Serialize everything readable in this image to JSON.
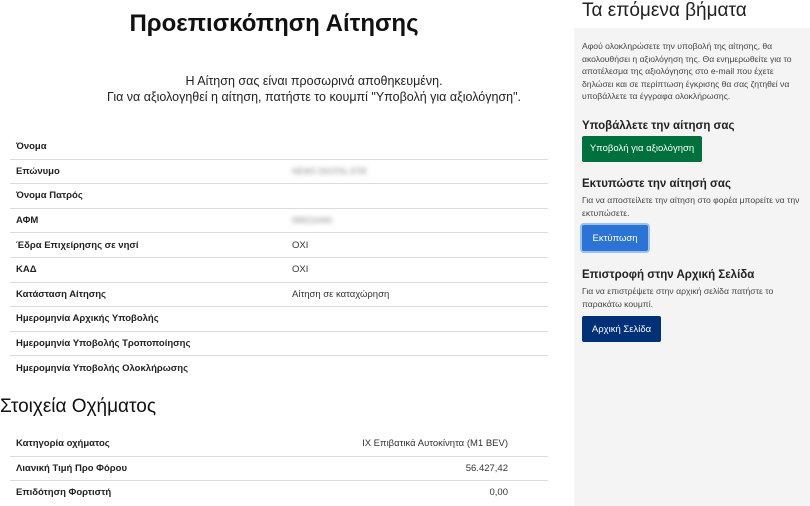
{
  "page": {
    "title": "Προεπισκόπηση Αίτησης",
    "notice_line1": "Η Αίτηση σας είναι προσωρινά αποθηκευμένη.",
    "notice_line2": "Για να αξιολογηθεί η αίτηση, πατήστε το κουμπί \"Υποβολή για αξιολόγηση\"."
  },
  "applicant": {
    "rows": [
      {
        "label": "Όνομα",
        "value": ""
      },
      {
        "label": "Επώνυμο",
        "value": "ΝΕΜΟ DIGITAL ΕΠΕ",
        "redacted": true
      },
      {
        "label": "Όνομα Πατρός",
        "value": ""
      },
      {
        "label": "ΑΦΜ",
        "value": "999210440",
        "redacted": true
      },
      {
        "label": "Έδρα Επιχείρησης σε νησί",
        "value": "ΟΧΙ"
      },
      {
        "label": "ΚΑΔ",
        "value": "ΟΧΙ"
      },
      {
        "label": "Κατάσταση Αίτησης",
        "value": "Αίτηση σε καταχώρηση"
      },
      {
        "label": "Ημερομηνία Αρχικής Υποβολής",
        "value": ""
      },
      {
        "label": "Ημερομηνία Υποβολής Τροποποίησης",
        "value": ""
      },
      {
        "label": "Ημερομηνία Υποβολής Ολοκλήρωσης",
        "value": ""
      }
    ]
  },
  "vehicle": {
    "title": "Στοιχεία Οχήματος",
    "rows": [
      {
        "label": "Κατηγορία οχήματος",
        "value": "ΙΧ Επιβατικά Αυτοκίνητα (M1 BEV)"
      },
      {
        "label": "Λιανική Τιμή Προ Φόρου",
        "value": "56.427,42"
      },
      {
        "label": "Επιδότηση Φορτιστή",
        "value": "0,00"
      }
    ]
  },
  "sidebar": {
    "title": "Τα επόμενα βήματα",
    "intro": "Αφού ολοκληρώσετε την υποβολή της αίτησης, θα ακολουθήσει η αξιολόγηση της. Θα ενημερωθείτε για το αποτέλεσμα της αξιολόγησης στο e-mail που έχετε δηλώσει και σε περίπτωση έγκρισης θα σας ζητηθεί να υποβάλλετε τα έγγραφα ολοκλήρωσης.",
    "submit_heading": "Υποβάλλετε την αίτηση σας",
    "submit_button": "Υποβολή για αξιολόγηση",
    "print_heading": "Εκτυπώστε την αίτησή σας",
    "print_text": "Για να αποστείλετε την αίτηση στο φορέα μπορείτε να την εκτυπώσετε.",
    "print_button": "Εκτύπωση",
    "home_heading": "Επιστροφή στην Αρχική Σελίδα",
    "home_text": "Για να επιστρέψετε στην αρχική σελίδα πατήστε το παρακάτω κουμπί.",
    "home_button": "Αρχική Σελίδα"
  },
  "colors": {
    "submit": "#00703c",
    "print": "#2b74d6",
    "home": "#003078"
  }
}
